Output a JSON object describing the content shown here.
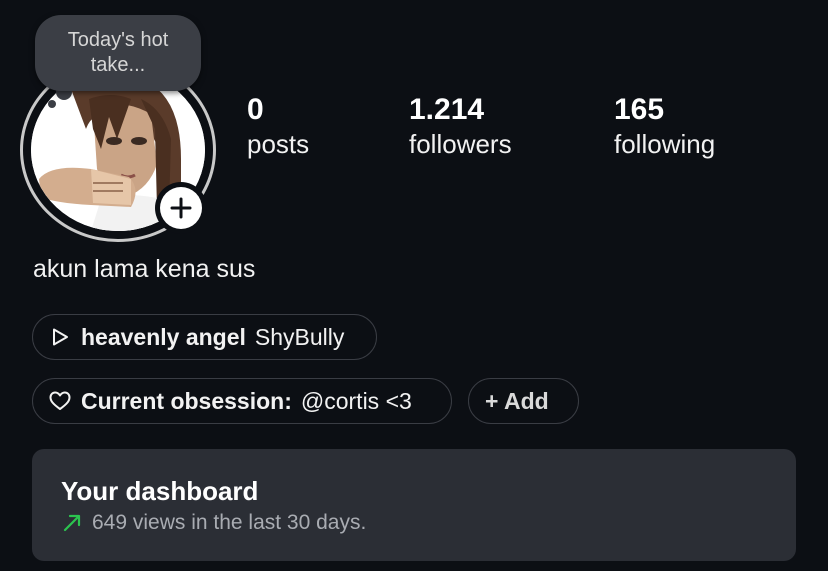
{
  "profile": {
    "note": "Today's hot take...",
    "stats": [
      {
        "count": "0",
        "label": "posts"
      },
      {
        "count": "1.214",
        "label": "followers"
      },
      {
        "count": "165",
        "label": "following"
      }
    ],
    "bio": "akun lama kena sus"
  },
  "music": {
    "title": "heavenly angel",
    "artist": "ShyBully",
    "icon": "play-icon"
  },
  "note_pill": {
    "label": "Current obsession:",
    "value": "@cortis <3",
    "icon": "heart-icon"
  },
  "add_pill": {
    "label": "+ Add"
  },
  "dashboard": {
    "title": "Your dashboard",
    "subtitle": "649 views in the last 30 days.",
    "trend_color": "#2bc44f"
  },
  "colors": {
    "background": "#0c0f14",
    "card": "#2b2e35",
    "bubble": "#3b3e45"
  }
}
